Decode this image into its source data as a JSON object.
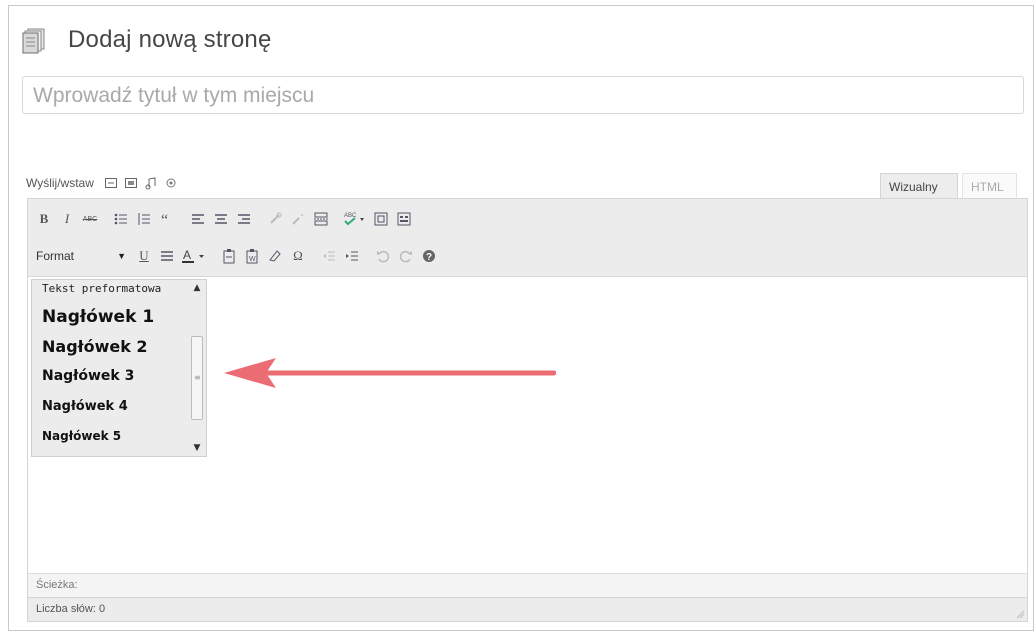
{
  "page": {
    "title": "Dodaj nową stronę"
  },
  "title_field": {
    "placeholder": "Wprowadź tytuł w tym miejscu"
  },
  "media": {
    "label": "Wyślij/wstaw",
    "icons": [
      "image-icon",
      "video-icon",
      "audio-icon",
      "media-icon"
    ]
  },
  "tabs": {
    "visual": "Wizualny",
    "html": "HTML"
  },
  "toolbar": {
    "row1": {
      "bold": "B",
      "italic": "I",
      "strike": "ABC"
    },
    "row2": {
      "format_label": "Format",
      "underline": "U",
      "omega": "Ω"
    }
  },
  "format_dropdown": {
    "items": [
      "Tekst preformatowa",
      "Nagłówek 1",
      "Nagłówek 2",
      "Nagłówek 3",
      "Nagłówek 4",
      "Nagłówek 5"
    ]
  },
  "status": {
    "path_label": "Ścieżka:",
    "word_count": "Liczba słów: 0"
  },
  "colors": {
    "arrow": "#ec6c74",
    "toolbar_bg": "#ececec"
  }
}
